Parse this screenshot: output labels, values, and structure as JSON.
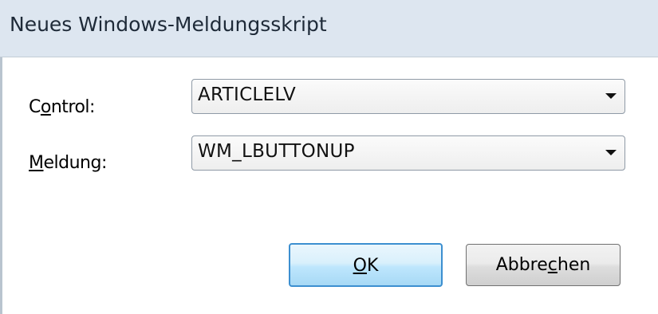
{
  "window": {
    "title": "Neues Windows-Meldungsskript"
  },
  "form": {
    "control": {
      "label_pre": "C",
      "label_accel": "o",
      "label_post": "ntrol:",
      "value": "ARTICLELV"
    },
    "meldung": {
      "label_pre": "",
      "label_accel": "M",
      "label_post": "eldung:",
      "value": "WM_LBUTTONUP"
    }
  },
  "buttons": {
    "ok": {
      "accel": "O",
      "post": "K"
    },
    "cancel": {
      "pre": "Abbre",
      "accel": "c",
      "post": "hen"
    }
  },
  "icons": {
    "dropdown": "chevron-down-icon"
  }
}
